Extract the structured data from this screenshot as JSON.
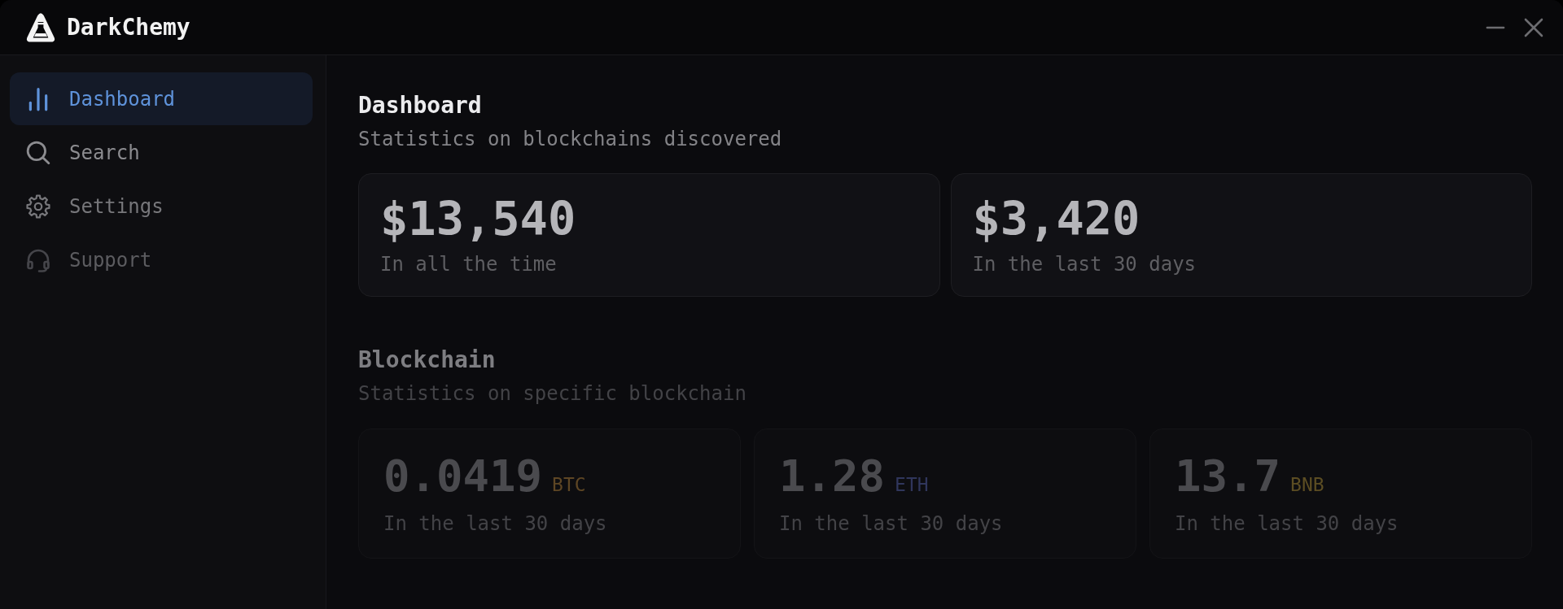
{
  "window": {
    "title": "DarkChemy"
  },
  "sidebar": {
    "items": [
      {
        "label": "Dashboard",
        "selected": true
      },
      {
        "label": "Search",
        "selected": false
      },
      {
        "label": "Settings",
        "selected": false
      },
      {
        "label": "Support",
        "selected": false
      }
    ]
  },
  "dashboard": {
    "title": "Dashboard",
    "subtitle": "Statistics on blockchains discovered",
    "cards": [
      {
        "value": "$13,540",
        "caption": "In all the time"
      },
      {
        "value": "$3,420",
        "caption": "In the last 30 days"
      }
    ]
  },
  "blockchain": {
    "title": "Blockchain",
    "subtitle": "Statistics on specific blockchain",
    "cards": [
      {
        "value": "0.0419",
        "currency": "BTC",
        "color": "#5e4624",
        "caption": "In the last 30 days"
      },
      {
        "value": "1.28",
        "currency": "ETH",
        "color": "#30365c",
        "caption": "In the last 30 days"
      },
      {
        "value": "13.7",
        "currency": "BNB",
        "color": "#5c4d23",
        "caption": "In the last 30 days"
      }
    ]
  }
}
